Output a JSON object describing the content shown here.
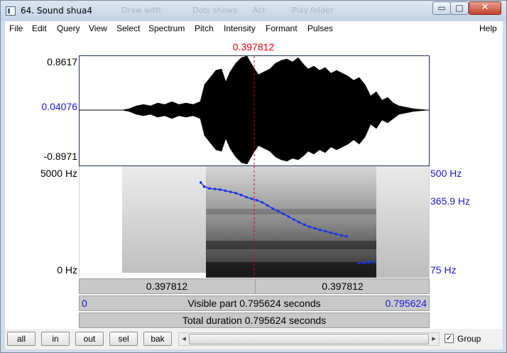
{
  "window": {
    "title": "64. Sound shua4",
    "ghost_items": [
      "Draw with",
      "Dots shows",
      "Act",
      "Play folder"
    ]
  },
  "icons": {
    "app": "praat-sound-icon",
    "minimize": "minimize-icon",
    "maximize": "maximize-icon",
    "close": "close-icon",
    "minimize_glyph": "▭",
    "maximize_glyph": "□",
    "close_glyph": "✕",
    "scroll_left": "◂",
    "scroll_right": "▸",
    "check": "✓"
  },
  "menu": [
    "File",
    "Edit",
    "Query",
    "View",
    "Select",
    "Spectrum",
    "Pitch",
    "Intensity",
    "Formant",
    "Pulses"
  ],
  "help": "Help",
  "cursor_time": "0.397812",
  "waveform": {
    "max": "0.8617",
    "mid": "0.04076",
    "min": "-0.8971"
  },
  "spectrogram": {
    "freq_top": "5000 Hz",
    "freq_bottom": "0 Hz",
    "pitch_top": "500 Hz",
    "pitch_mid": "365.9 Hz",
    "pitch_bottom": "75 Hz"
  },
  "bars": {
    "left_segment": "0.397812",
    "right_segment": "0.397812",
    "visible_start": "0",
    "visible_text": "Visible part 0.795624 seconds",
    "visible_end": "0.795624",
    "total_text": "Total duration 0.795624 seconds"
  },
  "buttons": [
    "all",
    "in",
    "out",
    "sel",
    "bak"
  ],
  "group": {
    "label": "Group",
    "checked": true
  },
  "colors": {
    "cursor": "#e8000b",
    "axis_blue": "#1a1ad6",
    "pitch": "#1a33e8"
  },
  "pitch_contour": {
    "unit": "Hz",
    "segments": [
      {
        "t": [
          0.276,
          0.284,
          0.296,
          0.308,
          0.32,
          0.332,
          0.344,
          0.356,
          0.368,
          0.38,
          0.392,
          0.404,
          0.416,
          0.428,
          0.44,
          0.452,
          0.464,
          0.476,
          0.488,
          0.5,
          0.512,
          0.524,
          0.536,
          0.548,
          0.56,
          0.572,
          0.584,
          0.596,
          0.608
        ],
        "f0": [
          490,
          470,
          462,
          459,
          456,
          451,
          445,
          439,
          430,
          420,
          412,
          405,
          395,
          380,
          365,
          353,
          340,
          327,
          313,
          300,
          288,
          278,
          270,
          263,
          257,
          250,
          243,
          237,
          232
        ]
      },
      {
        "t": [
          0.636,
          0.648,
          0.66,
          0.672
        ],
        "f0": [
          104,
          106,
          108,
          110
        ]
      }
    ]
  }
}
